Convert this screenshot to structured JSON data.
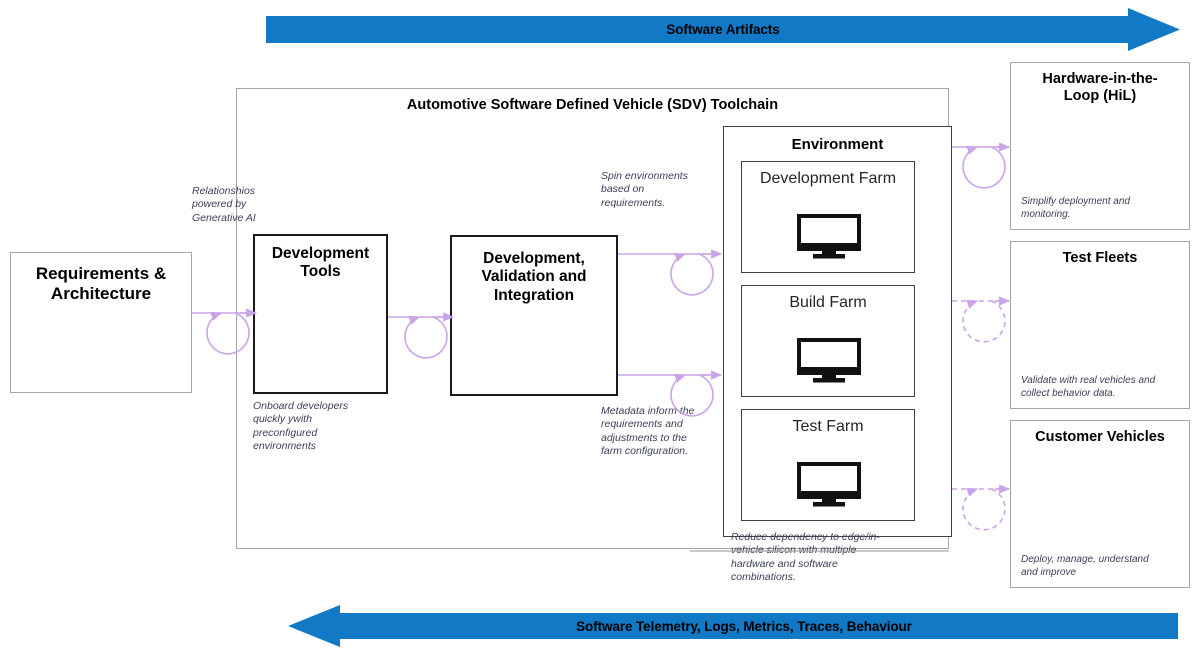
{
  "diagram": {
    "title": "Automotive Software Defined Vehicle (SDV) Toolchain",
    "accent_blue": "#1279c6",
    "connector_violet": "#cba3e8",
    "note_color": "#3b3f58"
  },
  "banners": {
    "top": {
      "label": "Software Artifacts",
      "direction": "right",
      "color": "#1279c6"
    },
    "bottom": {
      "label": "Software Telemetry, Logs, Metrics, Traces, Behaviour",
      "direction": "left",
      "color": "#1279c6"
    }
  },
  "left_stage": {
    "title": "Requirements &\nArchitecture"
  },
  "toolchain": {
    "title": "Automotive Software Defined Vehicle (SDV) Toolchain",
    "stages": [
      {
        "key": "development_tools",
        "title": "Development\nTools",
        "note": "Onboard developers\nquickly ywith\npreconfigured\nenvironments"
      },
      {
        "key": "development_validation_integration",
        "title": "Development,\nValidation and\nIntegration",
        "note_top": "Spin environments\nbased on\nrequirements.",
        "note_bottom": "Metadata inform the\nrequirements and\nadjustments to the\nfarm configuration."
      }
    ],
    "environment": {
      "title": "Environment",
      "farms": [
        {
          "key": "development-farm",
          "label": "Development Farm",
          "icon": "monitor-icon"
        },
        {
          "key": "build-farm",
          "label": "Build Farm",
          "icon": "monitor-icon"
        },
        {
          "key": "test-farm",
          "label": "Test Farm",
          "icon": "monitor-icon"
        }
      ],
      "note": "Reduce dependency to edge/in-\nvehicle silicon with multiple\nhardware and software\ncombinations."
    }
  },
  "targets": [
    {
      "key": "hil",
      "title": "Hardware-in-the-\nLoop (HiL)",
      "note": "Simplify deployment and\nmonitoring."
    },
    {
      "key": "test-fleets",
      "title": "Test Fleets",
      "note": "Validate with real vehicles and\ncollect behavior data."
    },
    {
      "key": "customer-vehicles",
      "title": "Customer Vehicles",
      "note": "Deploy, manage, understand\nand improve"
    }
  ],
  "notes": {
    "requirements_to_tools": "Relationshios\npowered by\nGenerative AI"
  }
}
